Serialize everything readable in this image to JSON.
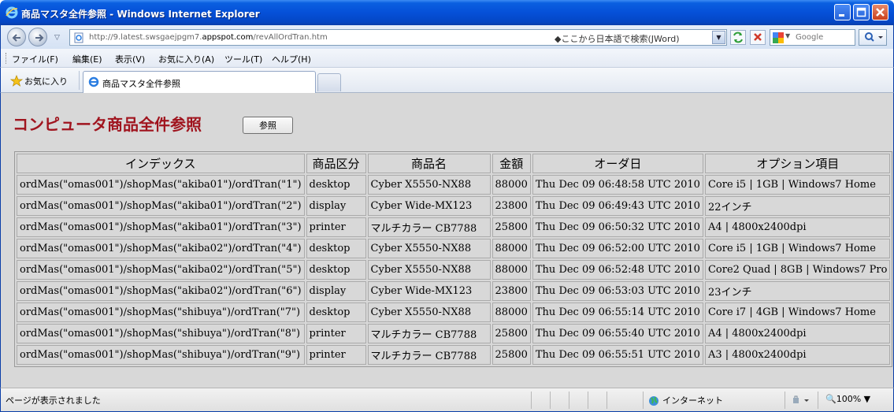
{
  "window": {
    "title": "商品マスタ全件参照 - Windows Internet Explorer"
  },
  "address_bar": {
    "url_prefix": "http://9.latest.swsgaejpgm7.",
    "url_domain": "appspot.com",
    "url_path": "/revAllOrdTran.htm",
    "search_note": "◆ここから日本語で検索(JWord)"
  },
  "search": {
    "placeholder": "Google"
  },
  "menu": {
    "items": [
      "ファイル(F)",
      "編集(E)",
      "表示(V)",
      "お気に入り(A)",
      "ツール(T)",
      "ヘルプ(H)"
    ]
  },
  "favorites": {
    "label": "お気に入り"
  },
  "tab": {
    "title": "商品マスタ全件参照"
  },
  "page": {
    "title": "コンピュータ商品全件参照",
    "view_button": "参照"
  },
  "table": {
    "headers": [
      "インデックス",
      "商品区分",
      "商品名",
      "金額",
      "オーダ日",
      "オプション項目"
    ],
    "rows": [
      [
        "ordMas(\"omas001\")/shopMas(\"akiba01\")/ordTran(\"1\")",
        "desktop",
        "Cyber X5550-NX88",
        "88000",
        "Thu Dec 09 06:48:58 UTC 2010",
        "Core i5 | 1GB | Windows7 Home"
      ],
      [
        "ordMas(\"omas001\")/shopMas(\"akiba01\")/ordTran(\"2\")",
        "display",
        "Cyber Wide-MX123",
        "23800",
        "Thu Dec 09 06:49:43 UTC 2010",
        "22インチ"
      ],
      [
        "ordMas(\"omas001\")/shopMas(\"akiba01\")/ordTran(\"3\")",
        "printer",
        "マルチカラー CB7788",
        "25800",
        "Thu Dec 09 06:50:32 UTC 2010",
        "A4 | 4800x2400dpi"
      ],
      [
        "ordMas(\"omas001\")/shopMas(\"akiba02\")/ordTran(\"4\")",
        "desktop",
        "Cyber X5550-NX88",
        "88000",
        "Thu Dec 09 06:52:00 UTC 2010",
        "Core i5 | 1GB | Windows7 Home"
      ],
      [
        "ordMas(\"omas001\")/shopMas(\"akiba02\")/ordTran(\"5\")",
        "desktop",
        "Cyber X5550-NX88",
        "88000",
        "Thu Dec 09 06:52:48 UTC 2010",
        "Core2 Quad | 8GB | Windows7 Pro"
      ],
      [
        "ordMas(\"omas001\")/shopMas(\"akiba02\")/ordTran(\"6\")",
        "display",
        "Cyber Wide-MX123",
        "23800",
        "Thu Dec 09 06:53:03 UTC 2010",
        "23インチ"
      ],
      [
        "ordMas(\"omas001\")/shopMas(\"shibuya\")/ordTran(\"7\")",
        "desktop",
        "Cyber X5550-NX88",
        "88000",
        "Thu Dec 09 06:55:14 UTC 2010",
        "Core i7 | 4GB | Windows7 Home"
      ],
      [
        "ordMas(\"omas001\")/shopMas(\"shibuya\")/ordTran(\"8\")",
        "printer",
        "マルチカラー CB7788",
        "25800",
        "Thu Dec 09 06:55:40 UTC 2010",
        "A4 | 4800x2400dpi"
      ],
      [
        "ordMas(\"omas001\")/shopMas(\"shibuya\")/ordTran(\"9\")",
        "printer",
        "マルチカラー CB7788",
        "25800",
        "Thu Dec 09 06:55:51 UTC 2010",
        "A3 | 4800x2400dpi"
      ]
    ]
  },
  "status": {
    "text": "ページが表示されました",
    "zone": "インターネット",
    "zoom": "100%"
  },
  "icons": {
    "app": "ie-icon",
    "back": "back-arrow-icon",
    "forward": "forward-arrow-icon",
    "refresh": "refresh-icon",
    "stop": "stop-icon",
    "search": "search-icon",
    "favorites": "star-icon",
    "zone": "globe-icon"
  },
  "colors": {
    "title_bar": "#0550d8",
    "page_title": "#a0141e",
    "content_bg": "#d8d8d8"
  }
}
